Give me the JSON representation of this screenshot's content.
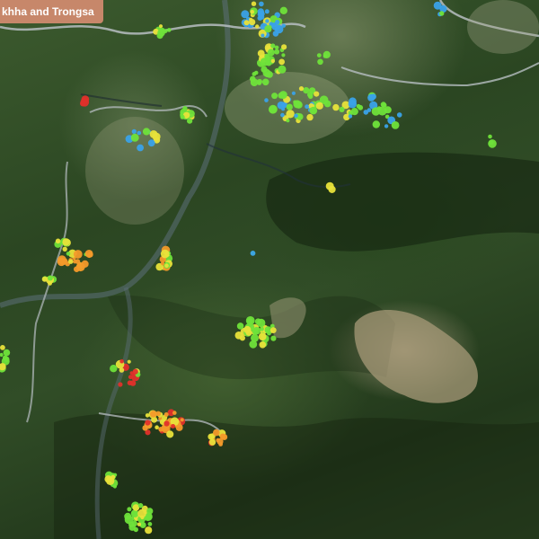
{
  "map": {
    "title": "khha and Trongsa",
    "basemap": "satellite",
    "colors": {
      "banner": "#c7876a",
      "marker_green": "#6fe23a",
      "marker_yellow": "#e8e23a",
      "marker_orange": "#f39a2a",
      "marker_red": "#e0302a",
      "marker_blue": "#3aa2e8",
      "road": "#9aa3a8"
    }
  }
}
